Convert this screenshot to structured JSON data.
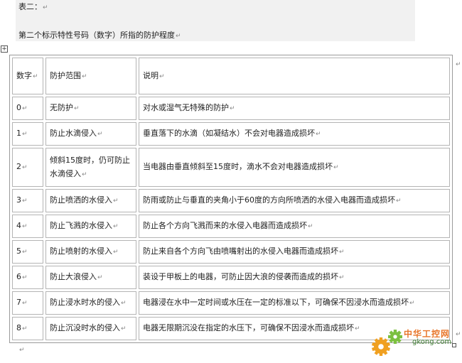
{
  "document": {
    "header_line1": "表二：",
    "header_line2": "第二个标示特性号码（数字）所指的防护程度",
    "paragraph_mark": "↵"
  },
  "table": {
    "headers": [
      "数字",
      "防护范围",
      "说明"
    ],
    "rows": [
      [
        "0",
        "无防护",
        "对水或湿气无特殊的防护"
      ],
      [
        "1",
        "防止水滴侵入",
        "垂直落下的水滴（如凝结水）不会对电器造成损坏"
      ],
      [
        "2",
        "倾斜15度时，仍可防止水滴侵入",
        "当电器由垂直倾斜至15度时，滴水不会对电器造成损坏"
      ],
      [
        "3",
        "防止喷洒的水侵入",
        "防雨或防止与垂直的夹角小于60度的方向所喷洒的水侵入电器而造成损坏"
      ],
      [
        "4",
        "防止飞溅的水侵入",
        "防止各个方向飞溅而来的水侵入电器而造成损坏"
      ],
      [
        "5",
        "防止喷射的水侵入",
        "防止来自各个方向飞由喷嘴射出的水侵入电器而造成损坏"
      ],
      [
        "6",
        "防止大浪侵入",
        "装设于甲板上的电器，可防止因大浪的侵袭而造成的损坏"
      ],
      [
        "7",
        "防止浸水时水的侵入",
        "电器浸在水中一定时间或水压在一定的标准以下，可确保不因浸水而造成损坏"
      ],
      [
        "8",
        "防止沉没时水的侵入",
        "电器无限期沉没在指定的水压下，可确保不因浸水而造成损坏"
      ]
    ]
  },
  "watermark": {
    "text": "中华工控网",
    "url": "gkong.com",
    "gear_color_1": "#f0a020",
    "gear_color_2": "#7cc040"
  },
  "icons": {
    "move_handle": "table-move-icon",
    "resize_handle": "table-resize-icon"
  }
}
